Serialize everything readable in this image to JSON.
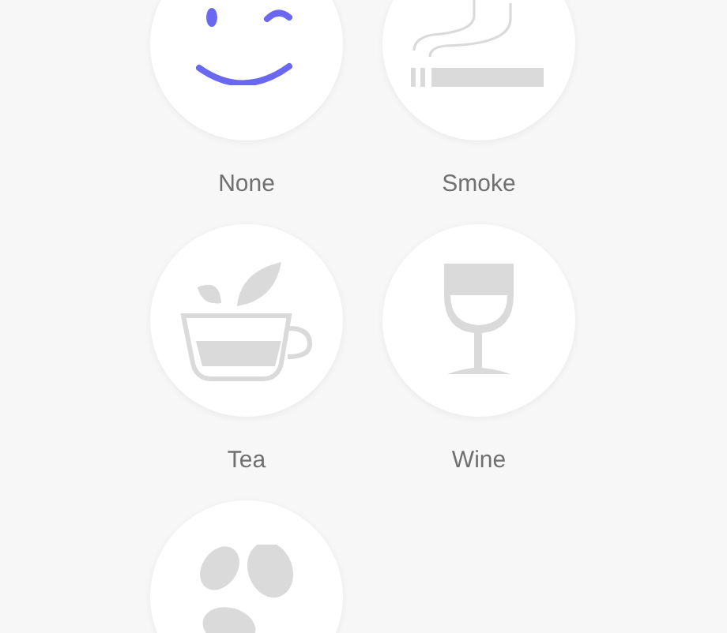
{
  "options": [
    {
      "kind": "none",
      "label": "None",
      "selected": true
    },
    {
      "kind": "smoke",
      "label": "Smoke",
      "selected": false
    },
    {
      "kind": "tea",
      "label": "Tea",
      "selected": false
    },
    {
      "kind": "wine",
      "label": "Wine",
      "selected": false
    },
    {
      "kind": "coffee",
      "selected": false
    }
  ]
}
